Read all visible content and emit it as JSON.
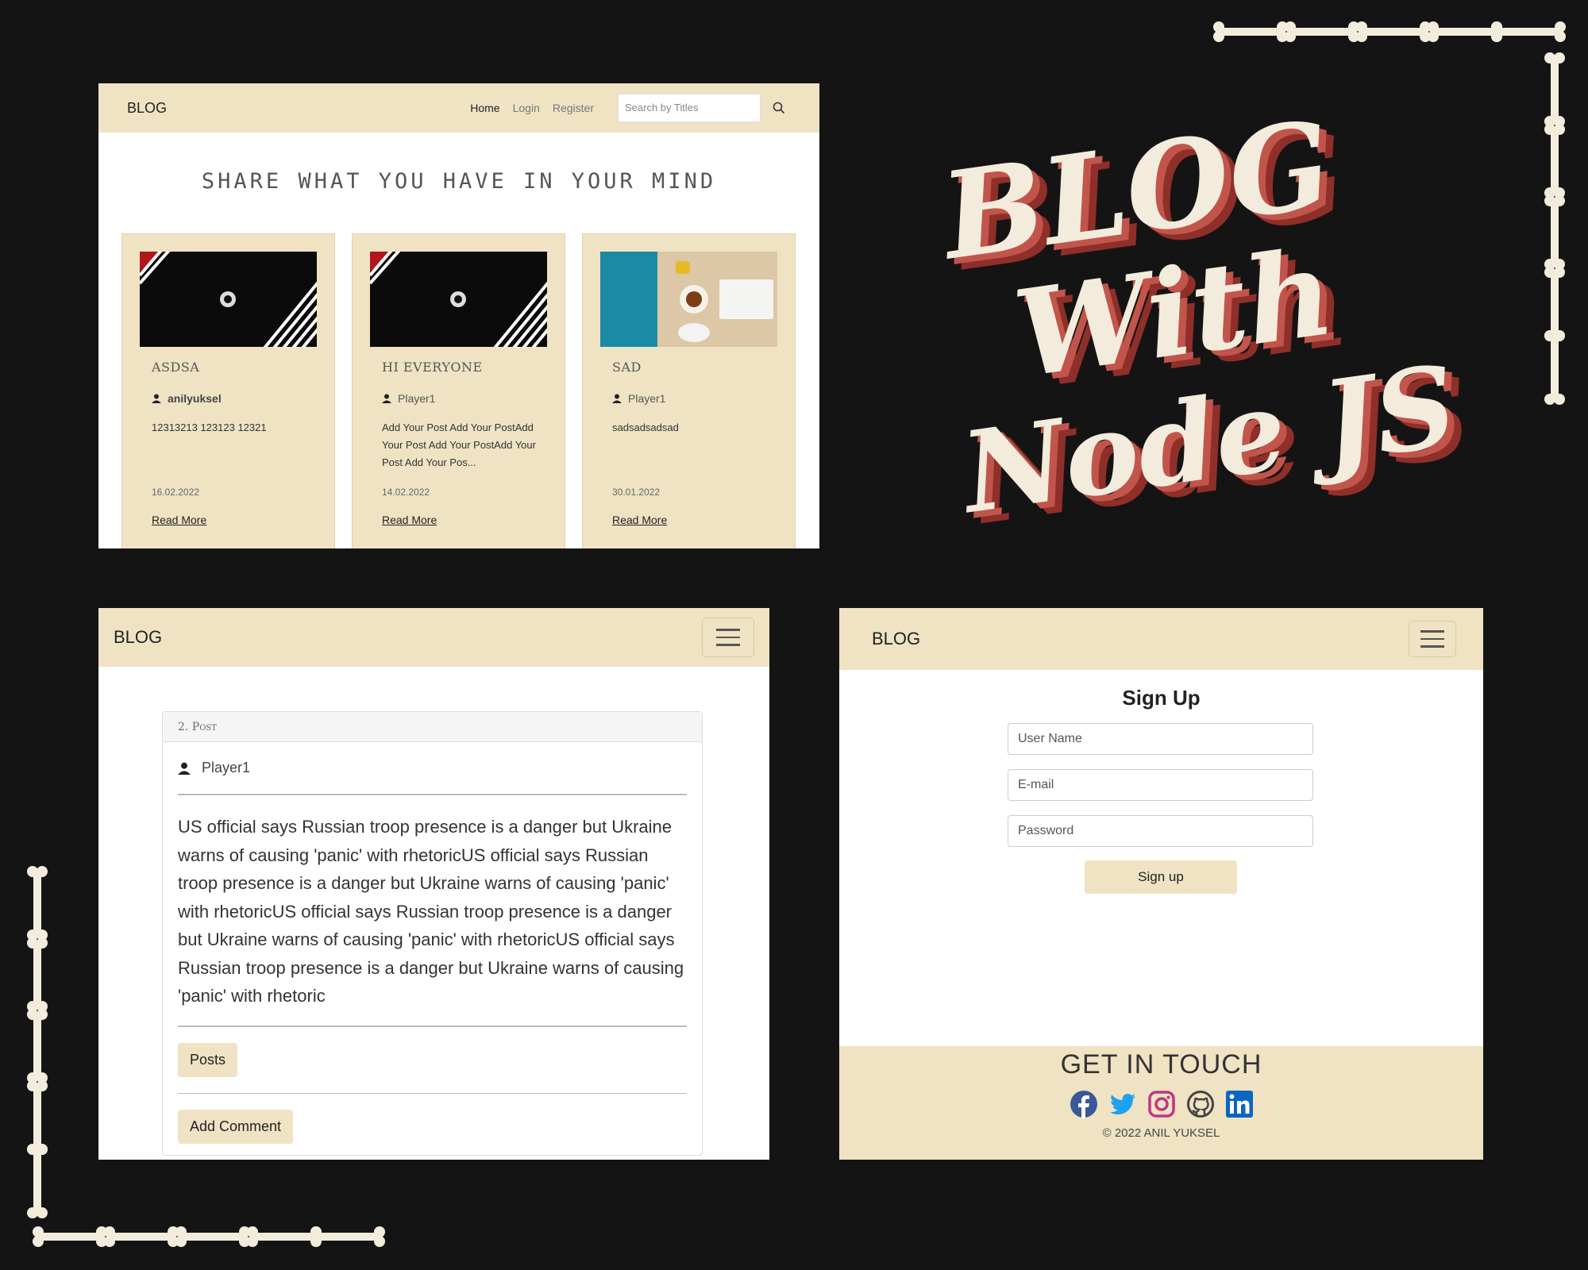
{
  "promo": {
    "title_lines": [
      "BLOG",
      "With",
      "Node JS"
    ]
  },
  "colors": {
    "background": "#151414",
    "beige": "#efe3c4",
    "logo_fill": "#f3ecdc",
    "logo_shadow": "#c2554b"
  },
  "home": {
    "brand": "BLOG",
    "nav": {
      "home": "Home",
      "login": "Login",
      "register": "Register"
    },
    "search": {
      "placeholder": "Search by Titles"
    },
    "hero": "SHARE WHAT YOU HAVE IN YOUR MIND",
    "cards": [
      {
        "title": "ASDSA",
        "author": "anilyuksel",
        "excerpt": "12313213 123123 12321",
        "date": "16.02.2022",
        "link": "Read More",
        "image": "besiktas-banner"
      },
      {
        "title": "HI EVERYONE",
        "author": "Player1",
        "excerpt": "Add Your  Post Add Your PostAdd Your  Post Add Your PostAdd Your  Post Add Your Pos...",
        "date": "14.02.2022",
        "link": "Read More",
        "image": "besiktas-banner"
      },
      {
        "title": "SAD",
        "author": "Player1",
        "excerpt": "sadsadsadsad",
        "date": "30.01.2022",
        "link": "Read More",
        "image": "desk-photo"
      }
    ]
  },
  "post": {
    "brand": "BLOG",
    "header": "2. Post",
    "author": "Player1",
    "body": "US official says  Russian troop presence is a danger but Ukraine warns of causing 'panic' with rhetoricUS official says  Russian troop presence is a danger but Ukraine warns of causing 'panic' with rhetoricUS official says  Russian troop presence is a danger but Ukraine warns of causing 'panic' with rhetoricUS official says  Russian troop presence is a danger but Ukraine warns of causing 'panic' with rhetoric",
    "posts_button": "Posts",
    "comment_button": "Add Comment"
  },
  "signup": {
    "brand": "BLOG",
    "title": "Sign Up",
    "username_placeholder": "User Name",
    "email_placeholder": "E-mail",
    "password_placeholder": "Password",
    "submit": "Sign up",
    "footer_title": "GET IN TOUCH",
    "socials": [
      "facebook-icon",
      "twitter-icon",
      "instagram-icon",
      "github-icon",
      "linkedin-icon"
    ],
    "copyright": "© 2022 ANIL YUKSEL"
  }
}
